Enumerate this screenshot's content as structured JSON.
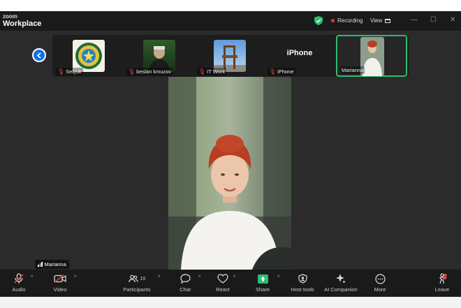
{
  "titlebar": {
    "logo_line1": "zoom",
    "logo_line2": "Workplace",
    "recording_label": "Recording",
    "view_label": "View",
    "window_controls": [
      "—",
      "☐",
      "✕"
    ]
  },
  "participants_strip": {
    "tiles": [
      {
        "name": "Selçuk",
        "muted": true,
        "thumb": "emblem"
      },
      {
        "name": "beslan kmuzov",
        "muted": true,
        "thumb": "man-green"
      },
      {
        "name": "IT Work",
        "muted": true,
        "thumb": "chair-sky"
      },
      {
        "name": "iPhone",
        "muted": true,
        "display_text": "iPhone"
      },
      {
        "name": "Marianna",
        "muted": false,
        "active": true,
        "thumb": "woman-car"
      }
    ]
  },
  "main_video": {
    "speaker_name": "Marianna"
  },
  "toolbar": {
    "participants_count": "10",
    "items": [
      {
        "label": "Audio",
        "icon": "mic-off-icon"
      },
      {
        "label": "Video",
        "icon": "video-off-icon"
      },
      {
        "label": "Participants",
        "icon": "participants-icon"
      },
      {
        "label": "Chat",
        "icon": "chat-icon"
      },
      {
        "label": "React",
        "icon": "heart-icon"
      },
      {
        "label": "Share",
        "icon": "share-icon"
      },
      {
        "label": "Host tools",
        "icon": "shield-icon"
      },
      {
        "label": "AI Companion",
        "icon": "sparkle-icon"
      },
      {
        "label": "More",
        "icon": "more-icon"
      },
      {
        "label": "Leave",
        "icon": "leave-icon"
      }
    ]
  },
  "colors": {
    "accent_blue": "#0e71eb",
    "active_green": "#2dbd6e",
    "mute_red": "#e0453a",
    "recording_red": "#e03a3a"
  }
}
